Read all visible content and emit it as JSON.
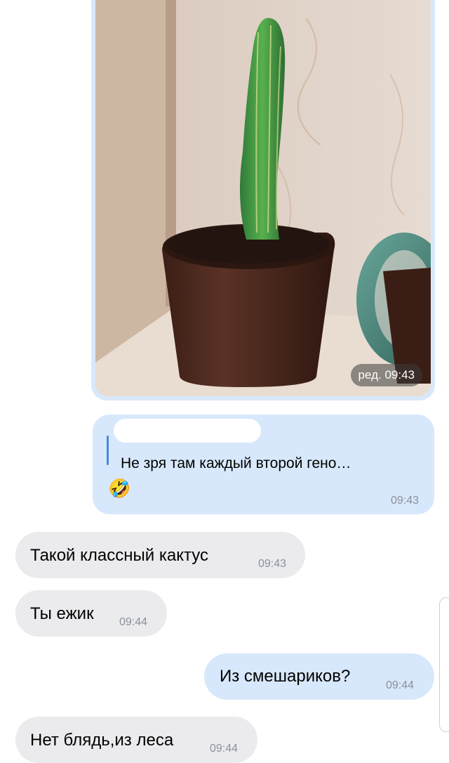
{
  "messages": [
    {
      "type": "photo",
      "direction": "outgoing",
      "time": "ред. 09:43"
    },
    {
      "type": "reply",
      "direction": "outgoing",
      "quote_text": "Не зря там каждый второй гено…",
      "emoji": "🤣",
      "time": "09:43"
    },
    {
      "type": "text",
      "direction": "incoming",
      "text": "Такой классный кактус",
      "time": "09:43"
    },
    {
      "type": "text",
      "direction": "incoming",
      "text": "Ты ежик",
      "time": "09:44"
    },
    {
      "type": "text",
      "direction": "outgoing",
      "text": "Из смешариков?",
      "time": "09:44"
    },
    {
      "type": "text",
      "direction": "incoming",
      "text": "Нет блядь,из леса",
      "time": "09:44"
    }
  ],
  "colors": {
    "outgoing_bubble": "#d8e8fc",
    "incoming_bubble": "#ebebee",
    "quote_accent": "#4a86d9"
  }
}
